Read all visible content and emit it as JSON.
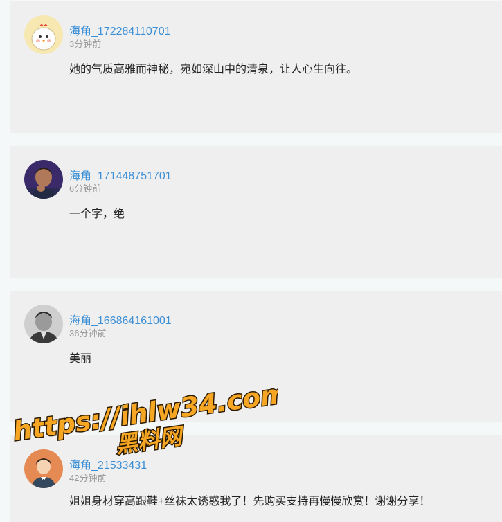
{
  "comments": [
    {
      "username": "海角_172284110701",
      "time": "3分钟前",
      "content": "她的气质高雅而神秘，宛如深山中的清泉，让人心生向往。",
      "avatar_icon": "chicken-avatar-icon"
    },
    {
      "username": "海角_171448751701",
      "time": "6分钟前",
      "content": "一个字，绝",
      "avatar_icon": "man-thinking-avatar-icon"
    },
    {
      "username": "海角_166864161001",
      "time": "36分钟前",
      "content": "美丽",
      "avatar_icon": "man-suit-avatar-icon"
    },
    {
      "username": "海角_21533431",
      "time": "42分钟前",
      "content": "姐姐身材穿高跟鞋+丝袜太诱惑我了！先购买支持再慢慢欣赏！谢谢分享！",
      "avatar_icon": "cartoon-man-avatar-icon"
    }
  ],
  "watermark": {
    "line1": "https://ihlw34.com",
    "line2": "黑料网"
  },
  "colors": {
    "username": "#3b8fd6",
    "time": "#9a9a9a",
    "card_bg": "#efefef",
    "page_bg": "#f5f8f9",
    "watermark_fill": "#f6a623"
  }
}
